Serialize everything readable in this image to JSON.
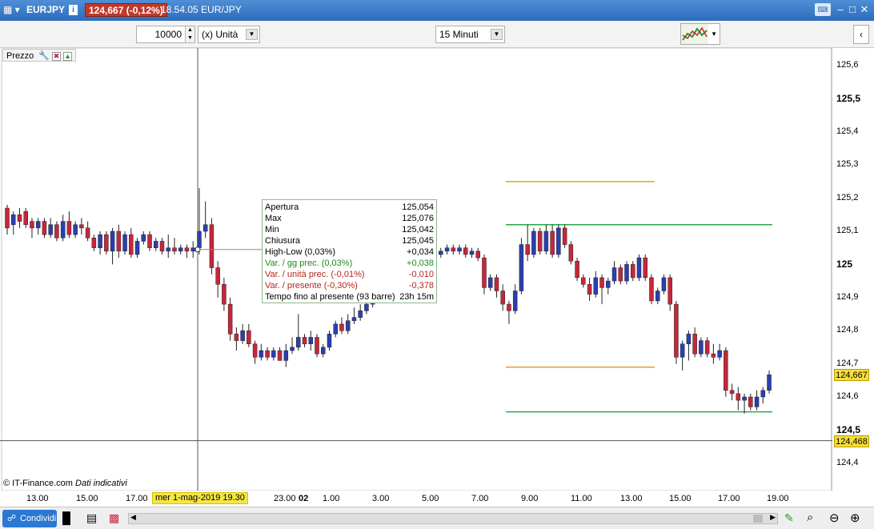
{
  "titlebar": {
    "symbol": "EURJPY",
    "info_icon": "i",
    "price_badge": "124,667 (-0,12%)",
    "time_symbol": "18.54.05 EUR/JPY"
  },
  "toolbar": {
    "quantity": "10000",
    "unit_select": "(x) Unità",
    "timeframe_select": "15 Minuti"
  },
  "legend": {
    "label": "Prezzo"
  },
  "tooltip": {
    "rows": [
      {
        "label": "Apertura",
        "value": "125,054",
        "color": "#000000"
      },
      {
        "label": "Max",
        "value": "125,076",
        "color": "#000000"
      },
      {
        "label": "Min",
        "value": "125,042",
        "color": "#000000"
      },
      {
        "label": "Chiusura",
        "value": "125,045",
        "color": "#000000"
      },
      {
        "label": "High-Low (0,03%)",
        "value": "+0,034",
        "color": "#000000"
      },
      {
        "label": "Var. / gg prec. (0,03%)",
        "value": "+0,038",
        "color": "#1e8a1e"
      },
      {
        "label": "Var. / unità prec. (-0,01%)",
        "value": "-0,010",
        "color": "#b3261e"
      },
      {
        "label": "Var. / presente (-0,30%)",
        "value": "-0,378",
        "color": "#b3261e"
      },
      {
        "label": "Tempo fino al presente (93 barre)",
        "value": "23h 15m",
        "color": "#000000"
      }
    ]
  },
  "yaxis": {
    "labels": [
      "125,6",
      "125,5",
      "125,4",
      "125,3",
      "125,2",
      "125,1",
      "125",
      "124,9",
      "124,8",
      "124,7",
      "124,6",
      "124,5",
      "124,4"
    ],
    "bold_labels": [
      "125,5",
      "125",
      "124,5"
    ],
    "current_price": "124,667",
    "crosshair_price": "124,468"
  },
  "xaxis": {
    "labels": [
      "13.00",
      "15.00",
      "17.00",
      "23.00",
      "02",
      "1.00",
      "3.00",
      "5.00",
      "7.00",
      "9.00",
      "11.00",
      "13.00",
      "15.00",
      "17.00",
      "19.00"
    ],
    "cursor_date": "mer 1-mag-2019 19.30"
  },
  "footer": {
    "copyright": "© IT-Finance.com",
    "note": "Dati indicativi",
    "share_button": "Condividi"
  },
  "colors": {
    "bull": "#2a3fb0",
    "bear": "#c8263b",
    "orange_line": "#e6a020",
    "green_line": "#2aa84a",
    "titlebar": "#3a7bc8"
  },
  "chart_data": {
    "type": "candlestick",
    "ylim": [
      124.35,
      125.65
    ],
    "lines": [
      {
        "color": "orange",
        "y": 125.25
      },
      {
        "color": "green",
        "y": 125.12
      },
      {
        "color": "orange",
        "y": 124.69
      },
      {
        "color": "green",
        "y": 124.555
      }
    ],
    "candles": [
      [
        125.17,
        125.11,
        125.18,
        125.09
      ],
      [
        125.12,
        125.15,
        125.16,
        125.09
      ],
      [
        125.15,
        125.13,
        125.17,
        125.11
      ],
      [
        125.16,
        125.12,
        125.17,
        125.11
      ],
      [
        125.13,
        125.11,
        125.14,
        125.08
      ],
      [
        125.11,
        125.13,
        125.14,
        125.09
      ],
      [
        125.13,
        125.09,
        125.14,
        125.08
      ],
      [
        125.09,
        125.12,
        125.14,
        125.08
      ],
      [
        125.12,
        125.08,
        125.13,
        125.07
      ],
      [
        125.08,
        125.13,
        125.15,
        125.07
      ],
      [
        125.13,
        125.09,
        125.16,
        125.08
      ],
      [
        125.09,
        125.12,
        125.13,
        125.08
      ],
      [
        125.12,
        125.11,
        125.14,
        125.09
      ],
      [
        125.11,
        125.08,
        125.13,
        125.07
      ],
      [
        125.08,
        125.05,
        125.09,
        125.04
      ],
      [
        125.05,
        125.09,
        125.1,
        125.03
      ],
      [
        125.09,
        125.04,
        125.1,
        125.03
      ],
      [
        125.04,
        125.1,
        125.11,
        125.0
      ],
      [
        125.1,
        125.04,
        125.12,
        125.02
      ],
      [
        125.04,
        125.09,
        125.1,
        125.03
      ],
      [
        125.09,
        125.03,
        125.11,
        125.02
      ],
      [
        125.03,
        125.07,
        125.08,
        125.02
      ],
      [
        125.07,
        125.09,
        125.1,
        125.06
      ],
      [
        125.09,
        125.05,
        125.1,
        125.04
      ],
      [
        125.05,
        125.07,
        125.08,
        125.04
      ],
      [
        125.07,
        125.04,
        125.08,
        125.03
      ],
      [
        125.04,
        125.05,
        125.09,
        125.02
      ],
      [
        125.05,
        125.04,
        125.08,
        125.03
      ],
      [
        125.04,
        125.05,
        125.06,
        125.03
      ],
      [
        125.05,
        125.04,
        125.06,
        125.02
      ],
      [
        125.04,
        125.05,
        125.07,
        125.02
      ],
      [
        125.05,
        125.1,
        125.23,
        125.03
      ],
      [
        125.1,
        125.12,
        125.19,
        125.08
      ],
      [
        125.12,
        124.99,
        125.14,
        124.97
      ],
      [
        124.99,
        124.94,
        125.01,
        124.9
      ],
      [
        124.94,
        124.88,
        124.96,
        124.86
      ],
      [
        124.88,
        124.79,
        124.9,
        124.77
      ],
      [
        124.79,
        124.77,
        124.81,
        124.74
      ],
      [
        124.77,
        124.8,
        124.82,
        124.76
      ],
      [
        124.8,
        124.76,
        124.82,
        124.75
      ],
      [
        124.76,
        124.72,
        124.77,
        124.7
      ],
      [
        124.72,
        124.74,
        124.76,
        124.71
      ],
      [
        124.74,
        124.72,
        124.75,
        124.71
      ],
      [
        124.72,
        124.74,
        124.75,
        124.71
      ],
      [
        124.74,
        124.71,
        124.75,
        124.71
      ],
      [
        124.71,
        124.74,
        124.76,
        124.69
      ],
      [
        124.74,
        124.75,
        124.78,
        124.73
      ],
      [
        124.75,
        124.78,
        124.85,
        124.74
      ],
      [
        124.78,
        124.76,
        124.79,
        124.75
      ],
      [
        124.76,
        124.78,
        124.8,
        124.74
      ],
      [
        124.78,
        124.73,
        124.79,
        124.72
      ],
      [
        124.73,
        124.75,
        124.76,
        124.72
      ],
      [
        124.75,
        124.79,
        124.8,
        124.74
      ],
      [
        124.79,
        124.82,
        124.83,
        124.78
      ],
      [
        124.82,
        124.8,
        124.84,
        124.79
      ],
      [
        124.8,
        124.83,
        124.85,
        124.79
      ],
      [
        124.83,
        124.84,
        124.87,
        124.82
      ],
      [
        124.84,
        124.86,
        124.88,
        124.83
      ],
      [
        124.86,
        124.88,
        124.9,
        124.85
      ],
      [
        124.88,
        124.91,
        124.93,
        124.87
      ],
      [
        124.91,
        124.95,
        124.97,
        124.9
      ],
      [
        124.95,
        125.0,
        125.02,
        124.94
      ],
      [
        125.0,
        125.05,
        125.06,
        124.99
      ],
      [
        125.05,
        125.08,
        125.1,
        125.04
      ],
      [
        125.08,
        125.05,
        125.09,
        125.04
      ],
      [
        125.05,
        125.03,
        125.06,
        125.02
      ],
      [
        125.03,
        125.04,
        125.05,
        125.02
      ],
      [
        125.04,
        125.02,
        125.05,
        125.01
      ],
      [
        125.02,
        125.04,
        125.05,
        125.01
      ],
      [
        125.04,
        125.03,
        125.05,
        125.02
      ],
      [
        125.03,
        125.04,
        125.05,
        125.02
      ],
      [
        125.04,
        125.05,
        125.06,
        125.03
      ],
      [
        125.05,
        125.04,
        125.06,
        125.03
      ],
      [
        125.04,
        125.05,
        125.06,
        125.03
      ],
      [
        125.05,
        125.03,
        125.06,
        125.02
      ],
      [
        125.03,
        125.04,
        125.05,
        125.02
      ],
      [
        125.04,
        125.02,
        125.05,
        125.01
      ],
      [
        125.02,
        124.93,
        125.03,
        124.91
      ],
      [
        124.93,
        124.96,
        124.97,
        124.92
      ],
      [
        124.96,
        124.92,
        124.97,
        124.9
      ],
      [
        124.92,
        124.88,
        124.94,
        124.86
      ],
      [
        124.88,
        124.86,
        124.89,
        124.82
      ],
      [
        124.86,
        124.92,
        124.94,
        124.85
      ],
      [
        124.92,
        125.06,
        125.08,
        124.91
      ],
      [
        125.06,
        125.03,
        125.12,
        125.01
      ],
      [
        125.03,
        125.1,
        125.11,
        125.02
      ],
      [
        125.1,
        125.04,
        125.11,
        125.03
      ],
      [
        125.04,
        125.1,
        125.12,
        125.03
      ],
      [
        125.1,
        125.03,
        125.12,
        125.02
      ],
      [
        125.03,
        125.11,
        125.12,
        125.02
      ],
      [
        125.11,
        125.06,
        125.12,
        125.05
      ],
      [
        125.06,
        125.01,
        125.07,
        125.0
      ],
      [
        125.01,
        124.96,
        125.02,
        124.95
      ],
      [
        124.96,
        124.94,
        124.97,
        124.93
      ],
      [
        124.94,
        124.91,
        124.96,
        124.89
      ],
      [
        124.91,
        124.96,
        124.98,
        124.9
      ],
      [
        124.96,
        124.93,
        124.97,
        124.88
      ],
      [
        124.93,
        124.95,
        124.96,
        124.91
      ],
      [
        124.95,
        124.99,
        125.01,
        124.94
      ],
      [
        124.99,
        124.95,
        125.0,
        124.94
      ],
      [
        124.95,
        125.0,
        125.01,
        124.94
      ],
      [
        125.0,
        124.96,
        125.01,
        124.95
      ],
      [
        124.96,
        125.02,
        125.03,
        124.95
      ],
      [
        125.02,
        124.96,
        125.03,
        124.95
      ],
      [
        124.96,
        124.89,
        124.97,
        124.88
      ],
      [
        124.89,
        124.92,
        124.93,
        124.88
      ],
      [
        124.92,
        124.96,
        124.97,
        124.91
      ],
      [
        124.96,
        124.88,
        124.97,
        124.86
      ],
      [
        124.88,
        124.72,
        124.89,
        124.7
      ],
      [
        124.72,
        124.76,
        124.77,
        124.68
      ],
      [
        124.76,
        124.79,
        124.8,
        124.71
      ],
      [
        124.79,
        124.73,
        124.81,
        124.72
      ],
      [
        124.73,
        124.77,
        124.78,
        124.72
      ],
      [
        124.77,
        124.73,
        124.78,
        124.72
      ],
      [
        124.73,
        124.72,
        124.76,
        124.7
      ],
      [
        124.72,
        124.74,
        124.76,
        124.71
      ],
      [
        124.74,
        124.62,
        124.75,
        124.6
      ],
      [
        124.62,
        124.61,
        124.64,
        124.59
      ],
      [
        124.61,
        124.59,
        124.63,
        124.56
      ],
      [
        124.59,
        124.6,
        124.61,
        124.55
      ],
      [
        124.6,
        124.57,
        124.61,
        124.56
      ],
      [
        124.57,
        124.6,
        124.62,
        124.56
      ],
      [
        124.6,
        124.62,
        124.63,
        124.58
      ],
      [
        124.62,
        124.667,
        124.68,
        124.61
      ]
    ]
  }
}
